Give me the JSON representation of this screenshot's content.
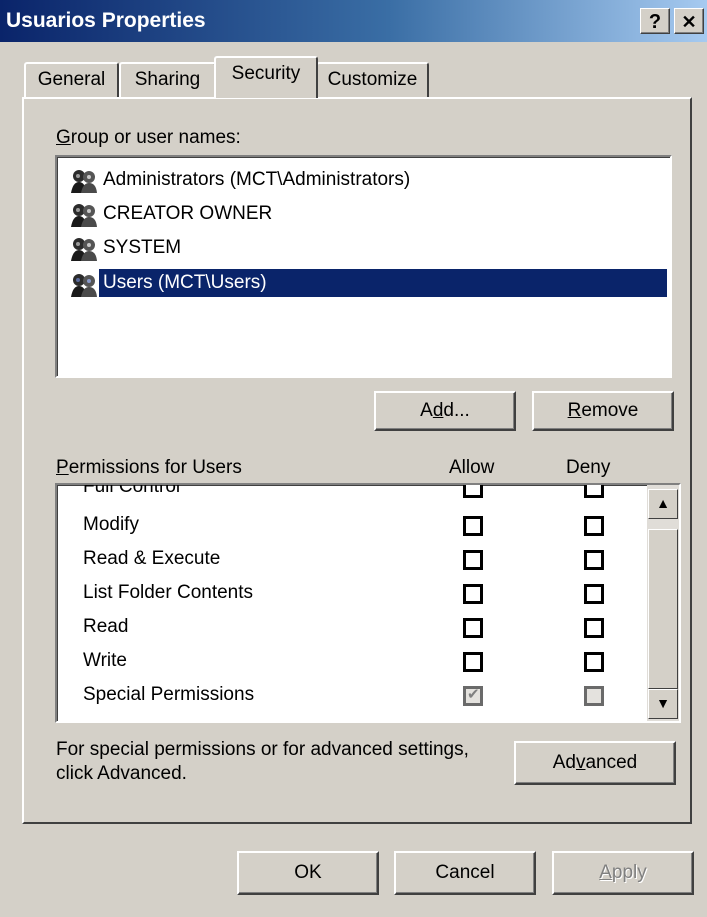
{
  "window": {
    "title": "Usuarios Properties",
    "help_label": "?",
    "close_label": "✕"
  },
  "tabs": [
    {
      "label": "General"
    },
    {
      "label": "Sharing"
    },
    {
      "label": "Security",
      "active": true
    },
    {
      "label": "Customize"
    }
  ],
  "groups": {
    "label_first": "G",
    "label_rest": "roup or user names:",
    "items": [
      {
        "label": "Administrators (MCT\\Administrators)",
        "icon": "users-icon"
      },
      {
        "label": "CREATOR OWNER",
        "icon": "users-icon"
      },
      {
        "label": "SYSTEM",
        "icon": "users-icon"
      },
      {
        "label": "Users (MCT\\Users)",
        "icon": "users-icon",
        "selected": true
      }
    ],
    "add_label_pre": "A",
    "add_label_u": "d",
    "add_label_post": "d...",
    "remove_label_u": "R",
    "remove_label_post": "emove"
  },
  "permissions": {
    "label_first": "P",
    "label_rest": "ermissions for Users",
    "allow_header": "Allow",
    "deny_header": "Deny",
    "items": [
      {
        "name": "Full Control",
        "allow": false,
        "deny": false
      },
      {
        "name": "Modify",
        "allow": false,
        "deny": false
      },
      {
        "name": "Read & Execute",
        "allow": false,
        "deny": false
      },
      {
        "name": "List Folder Contents",
        "allow": false,
        "deny": false
      },
      {
        "name": "Read",
        "allow": false,
        "deny": false
      },
      {
        "name": "Write",
        "allow": false,
        "deny": false
      },
      {
        "name": "Special Permissions",
        "allow": true,
        "deny": false,
        "inherited": true
      }
    ]
  },
  "advanced": {
    "note_line1": "For special permissions or for advanced settings,",
    "note_line2": "click Advanced.",
    "button_pre": "Ad",
    "button_u": "v",
    "button_post": "anced"
  },
  "footer": {
    "ok_label": "OK",
    "cancel_label": "Cancel",
    "apply_label_u": "A",
    "apply_label_post": "pply"
  },
  "colors": {
    "face": "#d4d0c8",
    "title_start": "#0a246a",
    "title_end": "#a6caf0",
    "selection": "#0a246a"
  }
}
